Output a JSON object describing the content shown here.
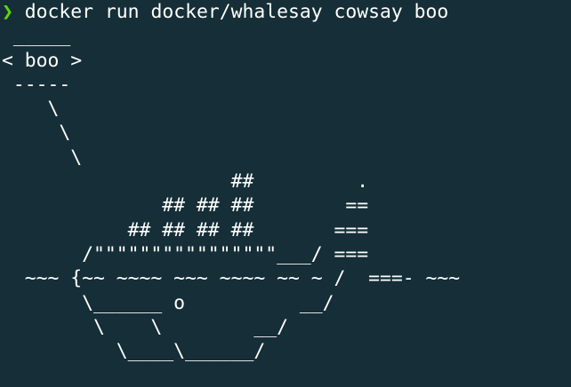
{
  "terminal": {
    "prompt_symbol": "❯",
    "command": "docker run docker/whalesay cowsay boo",
    "output": " _____\n< boo >\n -----\n    \\\n     \\\n      \\\n                    ##         .\n              ## ## ##        ==\n           ## ## ## ##       ===\n       /\"\"\"\"\"\"\"\"\"\"\"\"\"\"\"\"___/ ===\n  ~~~ {~~ ~~~~ ~~~ ~~~~ ~~ ~ /  ===- ~~~\n       \\______ o          __/\n        \\    \\        __/\n          \\____\\______/"
  },
  "colors": {
    "background": "#152e37",
    "text": "#ffffff",
    "prompt": "#5fd700"
  }
}
